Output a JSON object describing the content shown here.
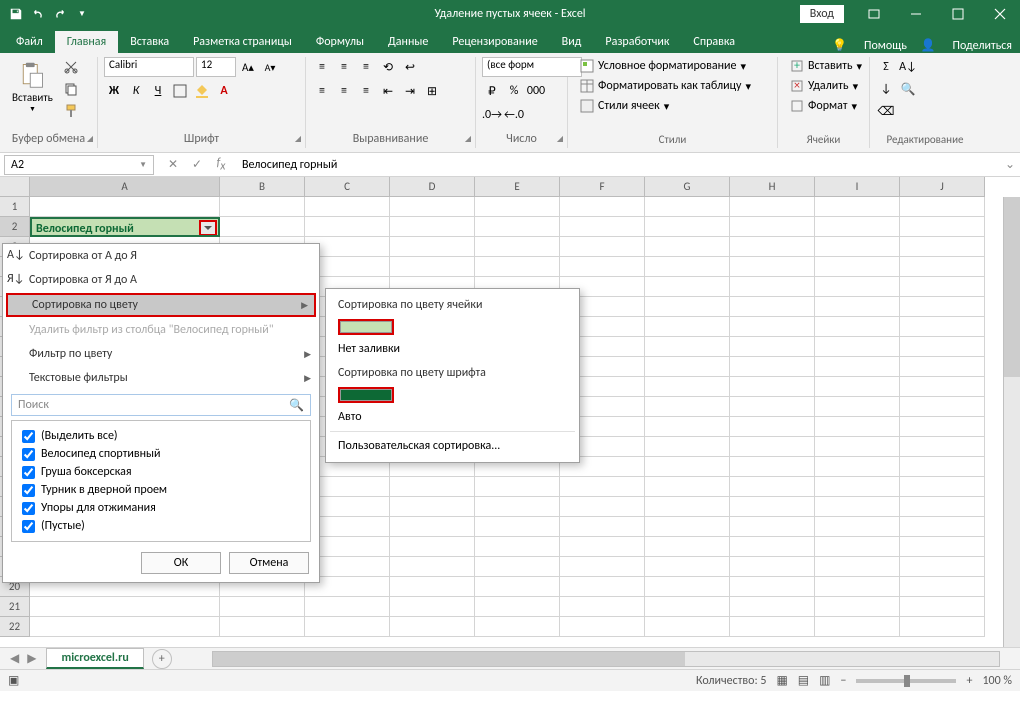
{
  "title": "Удаление пустых ячеек  -  Excel",
  "signin": "Вход",
  "tabs": {
    "file": "Файл",
    "home": "Главная",
    "insert": "Вставка",
    "layout": "Разметка страницы",
    "formulas": "Формулы",
    "data": "Данные",
    "review": "Рецензирование",
    "view": "Вид",
    "developer": "Разработчик",
    "help": "Справка",
    "tellme": "Помощь",
    "share": "Поделиться"
  },
  "ribbon": {
    "paste": "Вставить",
    "clipboard": "Буфер обмена",
    "font_name": "Calibri",
    "font_size": "12",
    "font_group": "Шрифт",
    "align_group": "Выравнивание",
    "number_format": "(все форм",
    "number_group": "Число",
    "cond_fmt": "Условное форматирование",
    "fmt_table": "Форматировать как таблицу",
    "cell_styles": "Стили ячеек",
    "styles_group": "Стили",
    "insert_cells": "Вставить",
    "delete_cells": "Удалить",
    "format_cells": "Формат",
    "cells_group": "Ячейки",
    "editing_group": "Редактирование"
  },
  "name_box": "A2",
  "formula": "Велосипед горный",
  "columns": [
    "A",
    "B",
    "C",
    "D",
    "E",
    "F",
    "G",
    "H",
    "I",
    "J"
  ],
  "cell_a2": "Велосипед горный",
  "filter": {
    "sort_az": "Сортировка от А до Я",
    "sort_za": "Сортировка от Я до А",
    "sort_color": "Сортировка по цвету",
    "clear": "Удалить фильтр из столбца \"Велосипед горный\"",
    "filter_color": "Фильтр по цвету",
    "text_filters": "Текстовые фильтры",
    "search_ph": "Поиск",
    "chk_all": "(Выделить все)",
    "chk1": "Велосипед спортивный",
    "chk2": "Груша боксерская",
    "chk3": "Турник в дверной проем",
    "chk4": "Упоры для отжимания",
    "chk_blank": "(Пустые)",
    "ok": "ОК",
    "cancel": "Отмена"
  },
  "submenu": {
    "by_cell": "Сортировка по цвету ячейки",
    "no_fill": "Нет заливки",
    "by_font": "Сортировка по цвету шрифта",
    "auto": "Авто",
    "custom": "Пользовательская сортировка..."
  },
  "sheet": "microexcel.ru",
  "status": {
    "count_lbl": "Количество: 5",
    "zoom": "100 %"
  }
}
